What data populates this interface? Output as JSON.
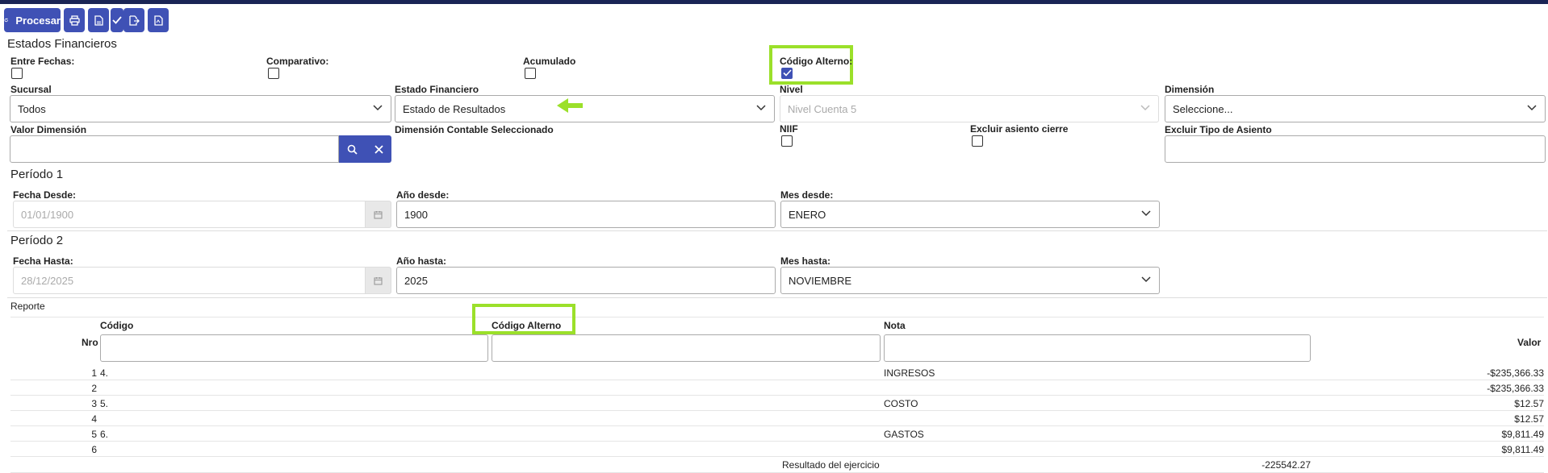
{
  "toolbar": {
    "process_label": "Procesar"
  },
  "form": {
    "title": "Estados Financieros",
    "entre_fechas_label": "Entre Fechas:",
    "comparativo_label": "Comparativo:",
    "acumulado_label": "Acumulado",
    "codigo_alterno_label": "Código Alterno:",
    "sucursal_label": "Sucursal",
    "sucursal_value": "Todos",
    "estado_financiero_label": "Estado Financiero",
    "estado_financiero_value": "Estado de Resultados",
    "nivel_label": "Nivel",
    "nivel_value": "Nivel Cuenta 5",
    "dimension_label": "Dimensión",
    "dimension_value": "Seleccione...",
    "valor_dimension_label": "Valor Dimensión",
    "dimension_contable_label": "Dimensión Contable Seleccionado",
    "niif_label": "NIIF",
    "excluir_cierre_label": "Excluir asiento cierre",
    "excluir_tipo_label": "Excluir Tipo de Asiento"
  },
  "periodo1": {
    "title": "Período 1",
    "fecha_label": "Fecha Desde:",
    "fecha_value": "01/01/1900",
    "anio_label": "Año desde:",
    "anio_value": "1900",
    "mes_label": "Mes desde:",
    "mes_value": "ENERO"
  },
  "periodo2": {
    "title": "Período 2",
    "fecha_label": "Fecha Hasta:",
    "fecha_value": "28/12/2025",
    "anio_label": "Año hasta:",
    "anio_value": "2025",
    "mes_label": "Mes hasta:",
    "mes_value": "NOVIEMBRE"
  },
  "reporte": {
    "title": "Reporte",
    "headers": {
      "nro": "Nro",
      "codigo": "Código",
      "codigo_alterno": "Código Alterno",
      "nota": "Nota",
      "valor": "Valor"
    },
    "rows": [
      {
        "nro": "1",
        "codigo": "4.",
        "nota": "INGRESOS",
        "valor": "-$235,366.33"
      },
      {
        "nro": "2",
        "codigo": "",
        "nota": "",
        "valor": "-$235,366.33"
      },
      {
        "nro": "3",
        "codigo": "5.",
        "nota": "COSTO",
        "valor": "$12.57"
      },
      {
        "nro": "4",
        "codigo": "",
        "nota": "",
        "valor": "$12.57"
      },
      {
        "nro": "5",
        "codigo": "6.",
        "nota": "GASTOS",
        "valor": "$9,811.49"
      },
      {
        "nro": "6",
        "codigo": "",
        "nota": "",
        "valor": "$9,811.49"
      }
    ],
    "resultado_label": "Resultado del ejercicio",
    "resultado_value": "-225542.27"
  },
  "colors": {
    "primary": "#3f51b5",
    "highlight": "#9be02a"
  }
}
